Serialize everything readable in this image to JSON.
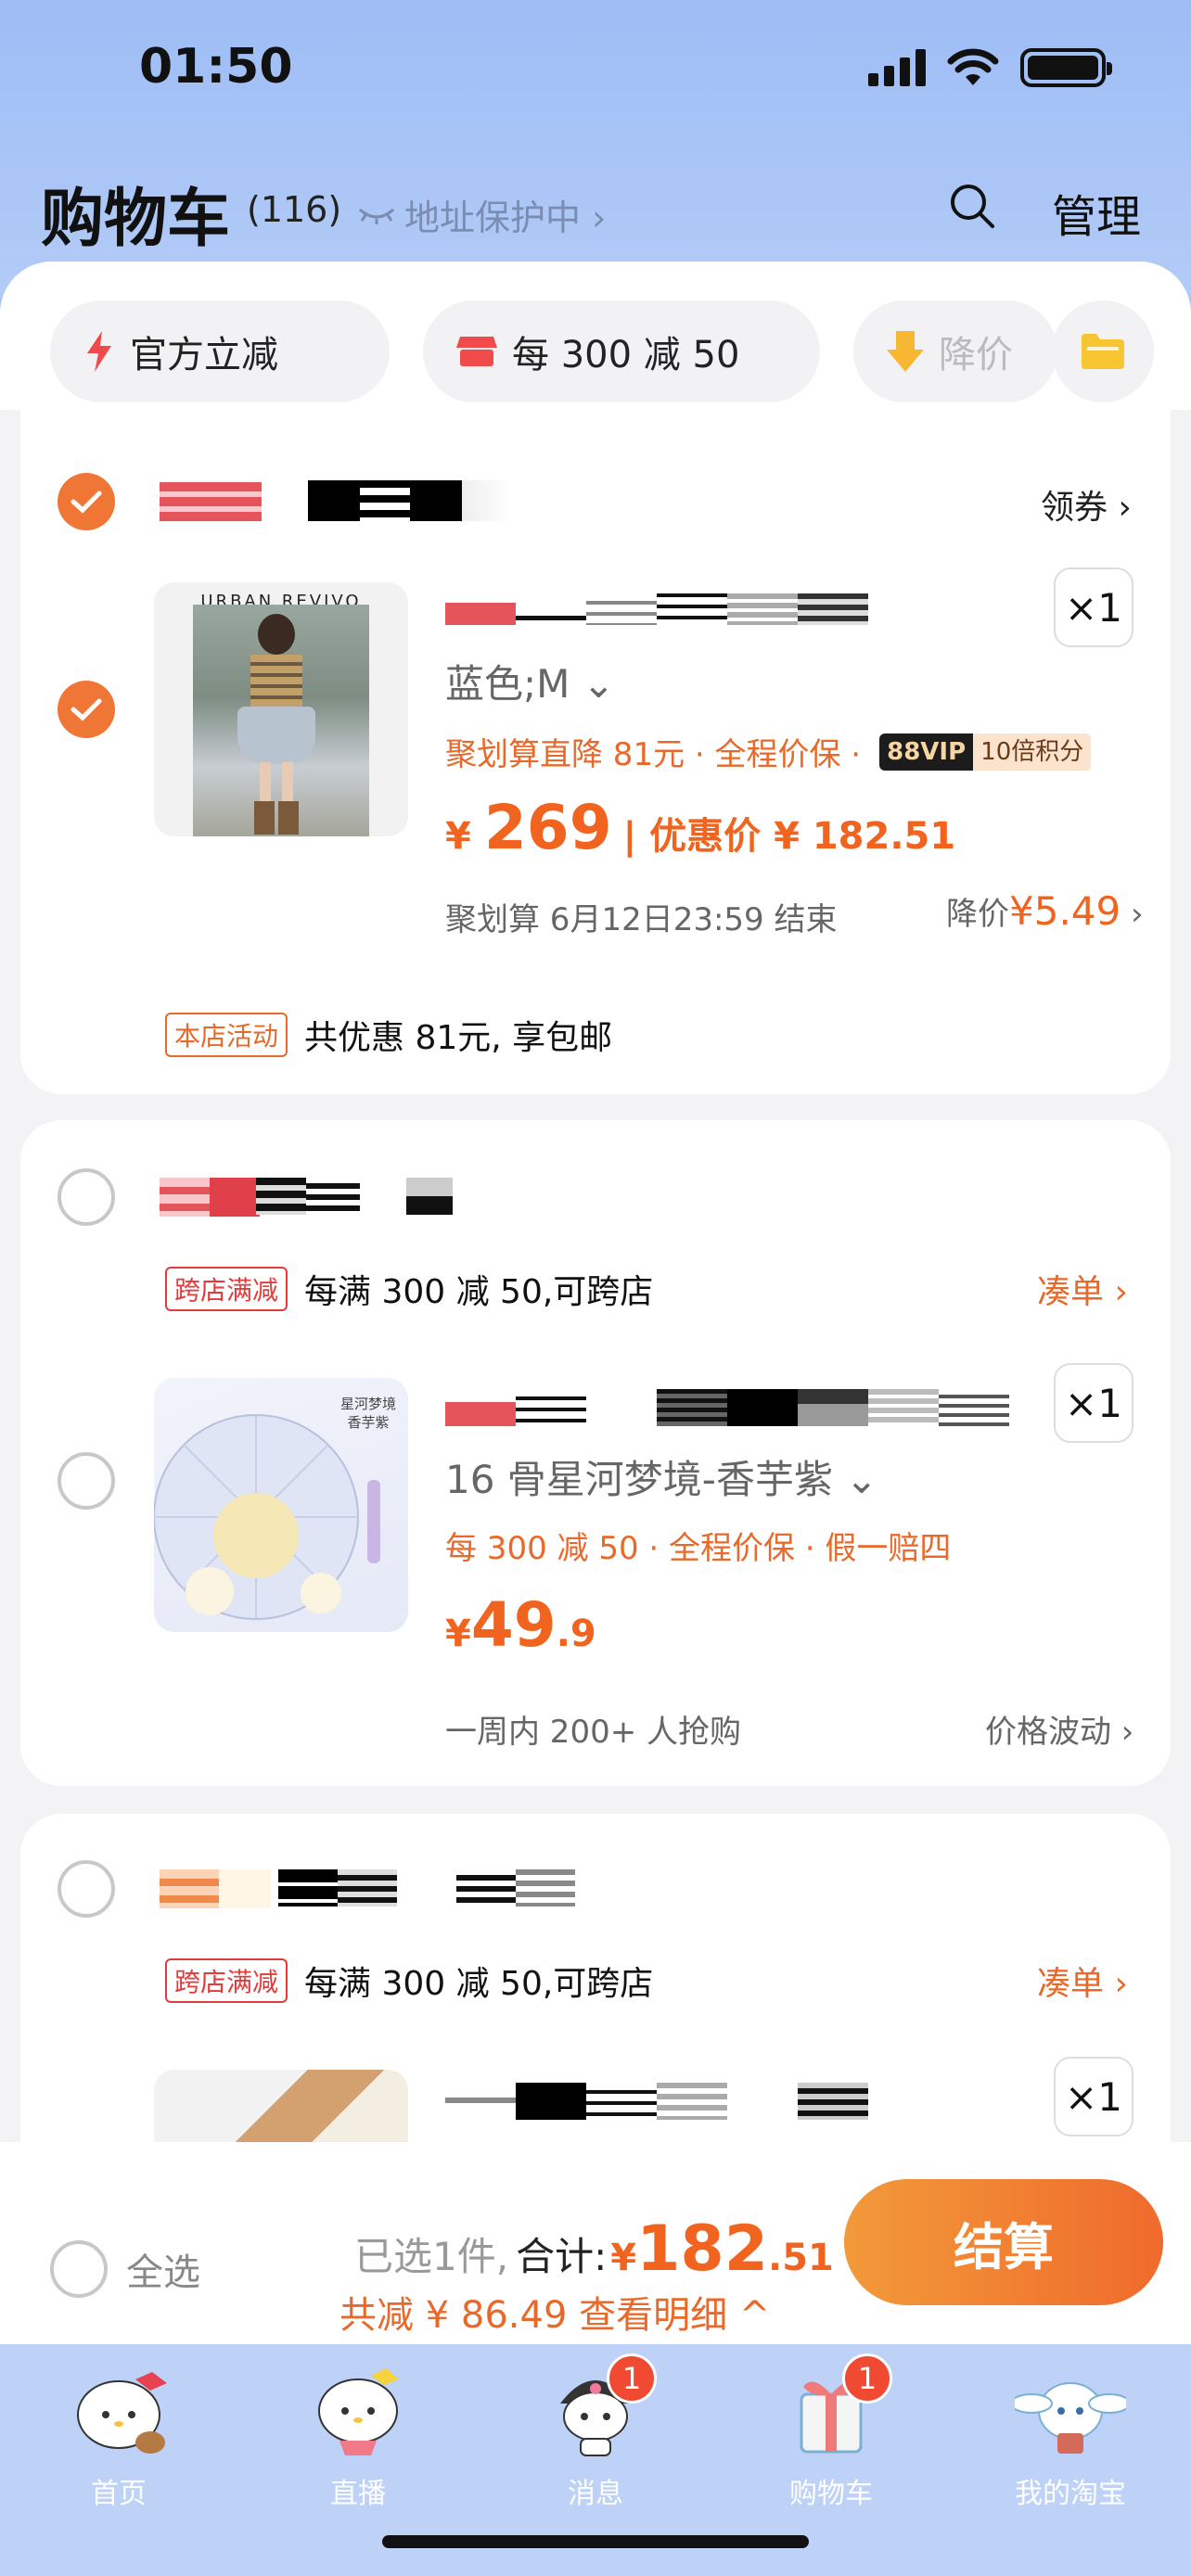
{
  "status_bar": {
    "time": "01:50"
  },
  "header": {
    "title": "购物车",
    "count": "(116)",
    "address": "地址保护中 ›",
    "manage": "管理"
  },
  "promo_chips": [
    {
      "label": "官方立减"
    },
    {
      "label": "每 300 减 50"
    },
    {
      "label": "降价"
    }
  ],
  "shops": [
    {
      "coupon_label": "领券 ›",
      "item": {
        "brand_on_image": "URBAN REVIVO",
        "sku": "蓝色;M ⌄",
        "promo": "聚划算直降 81元 · 全程价保 ·",
        "vip_badge": "88VIP",
        "vip_points": "10倍积分",
        "price_symbol": "¥",
        "price": "269",
        "discount_label": "| 优惠价 ¥ 182.51",
        "deadline": "聚划算 6月12日23:59 结束",
        "price_drop_label": "降价",
        "price_drop_value": "¥5.49",
        "qty": "×1"
      },
      "activity_tag": "本店活动",
      "activity_text": "共优惠 81元, 享包邮"
    },
    {
      "activity_tag": "跨店满减",
      "activity_text": "每满 300 减 50,可跨店",
      "action": "凑单 ›",
      "item": {
        "image_text": "星河梦境 香芋紫",
        "sku": "16 骨星河梦境-香芋紫 ⌄",
        "promo": "每 300 减 50 · 全程价保 · 假一赔四",
        "price_symbol": "¥",
        "price_int": "49",
        "price_dec": ".9",
        "sales": "一周内 200+ 人抢购",
        "right_label": "价格波动 ›",
        "qty": "×1"
      }
    },
    {
      "activity_tag": "跨店满减",
      "activity_text": "每满 300 减 50,可跨店",
      "action": "凑单 ›",
      "item": {
        "qty": "×1"
      }
    }
  ],
  "summary": {
    "select_all": "全选",
    "selected": "已选1件,",
    "total_label": "合计:",
    "total_symbol": "¥",
    "total_int": "182",
    "total_dec": ".51",
    "detail": "共减 ¥ 86.49  查看明细 ^",
    "checkout": "结算"
  },
  "tabs": [
    {
      "label": "首页",
      "badge": ""
    },
    {
      "label": "直播",
      "badge": ""
    },
    {
      "label": "消息",
      "badge": "1"
    },
    {
      "label": "购物车",
      "badge": "1"
    },
    {
      "label": "我的淘宝",
      "badge": ""
    }
  ],
  "colors": {
    "accent": "#f0641f",
    "bg_blue": "#a9c4f5",
    "tag_red": "#e23b3b"
  }
}
